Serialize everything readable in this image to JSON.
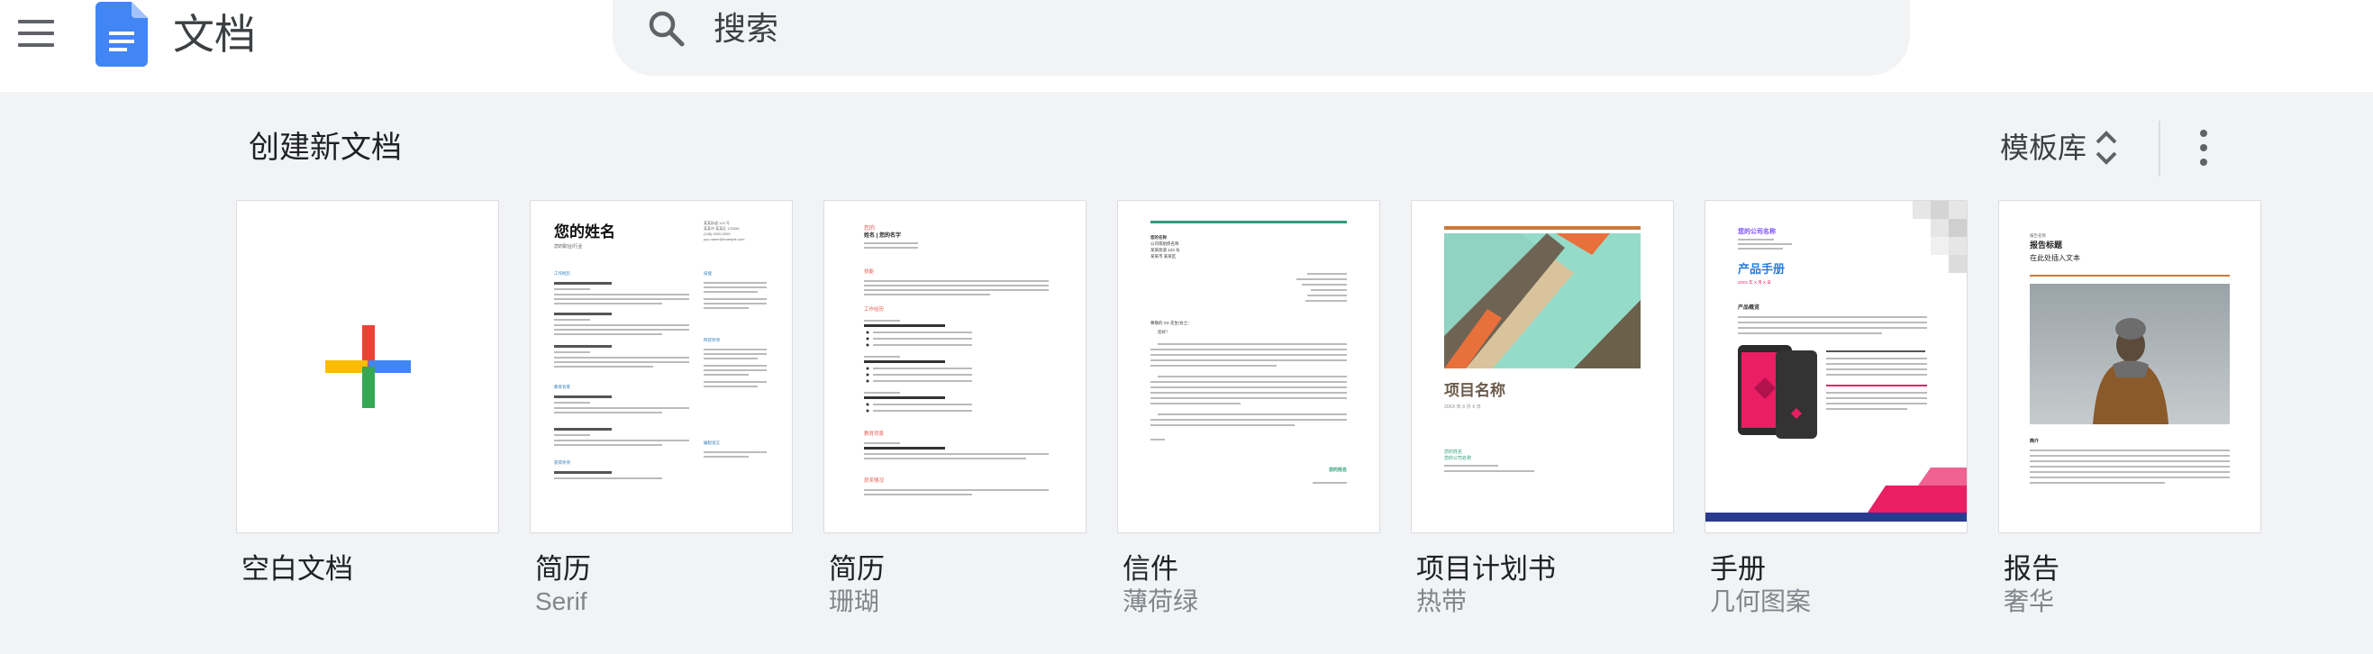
{
  "header": {
    "app_title": "文档",
    "search": {
      "placeholder": "搜索"
    }
  },
  "templates": {
    "section_title": "创建新文档",
    "gallery_label": "模板库",
    "items": [
      {
        "name": "空白文档",
        "subtitle": ""
      },
      {
        "name": "简历",
        "subtitle": "Serif"
      },
      {
        "name": "简历",
        "subtitle": "珊瑚"
      },
      {
        "name": "信件",
        "subtitle": "薄荷绿"
      },
      {
        "name": "项目计划书",
        "subtitle": "热带"
      },
      {
        "name": "手册",
        "subtitle": "几何图案"
      },
      {
        "name": "报告",
        "subtitle": "奢华"
      }
    ]
  },
  "thumbnails": {
    "resume_serif": {
      "name": "您的姓名",
      "sub": "您的职业/行业",
      "sections": [
        "工作经历",
        "教育背景",
        "获得奖项"
      ],
      "side_sections": [
        "技能",
        "所获奖项",
        "编程语言"
      ],
      "contact": [
        "某某街道 123 号",
        "某某市 某某区 123456",
        "(138) 0000-0000",
        "you.name@example.com"
      ]
    },
    "resume_coral": {
      "name_line1": "您的",
      "name_line2": "姓名 | 您的名字",
      "sections": [
        "技能",
        "工作经历",
        "教育背景",
        "获奖情况"
      ]
    },
    "letter": {
      "sender": [
        "您的名称",
        "公司或组织名称",
        "某某街道 123 号",
        "某某市 某某区"
      ],
      "greeting": "尊敬的 XX 先生/女士：",
      "closing": "您好！",
      "sign": "您的姓名"
    },
    "project": {
      "title": "项目名称",
      "date": "20XX 年 X 月 X 日",
      "owner": "您的姓名",
      "owner_sub": "您的公司名称"
    },
    "brochure": {
      "company": "您的公司名称",
      "title": "产品手册",
      "date": "20XX 年 X 月 X 日",
      "section": "产品概览"
    },
    "report": {
      "kicker": "报告名称",
      "title": "报告标题",
      "subtitle": "在此处插入文本",
      "section": "简介"
    }
  },
  "colors": {
    "docs_blue": "#4285f4",
    "google_red": "#ea4335",
    "google_yellow": "#fbbc04",
    "google_green": "#34a853",
    "coral": "#e8584b",
    "mint": "#2e9e7d",
    "brochure_purple": "#7c4dff",
    "brochure_pink": "#e91e63",
    "report_orange": "#c97b3a"
  }
}
